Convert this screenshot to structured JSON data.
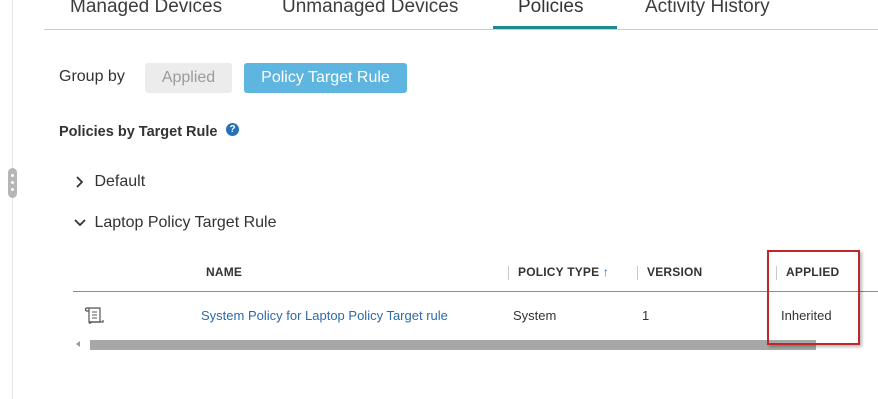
{
  "tabs": [
    {
      "label": "Managed Devices"
    },
    {
      "label": "Unmanaged Devices"
    },
    {
      "label": "Policies"
    },
    {
      "label": "Activity History"
    }
  ],
  "active_tab": "Policies",
  "group_by": {
    "label": "Group by",
    "options": [
      "Applied",
      "Policy Target Rule"
    ],
    "selected": "Policy Target Rule"
  },
  "section": {
    "title": "Policies by Target Rule",
    "help_icon": "?"
  },
  "groups": [
    {
      "label": "Default",
      "expanded": false
    },
    {
      "label": "Laptop Policy Target Rule",
      "expanded": true
    }
  ],
  "table": {
    "columns": [
      "NAME",
      "POLICY TYPE",
      "VERSION",
      "APPLIED"
    ],
    "sort_indicator": "↑",
    "rows": [
      {
        "icon": "policy-document-icon",
        "name": "System Policy for Laptop Policy Target rule",
        "policy_type": "System",
        "version": "1",
        "applied": "Inherited"
      }
    ]
  },
  "colors": {
    "accent": "#1d8a8f",
    "selected_button": "#5db5e0",
    "link": "#2d6aa6",
    "highlight": "#c0272d"
  }
}
